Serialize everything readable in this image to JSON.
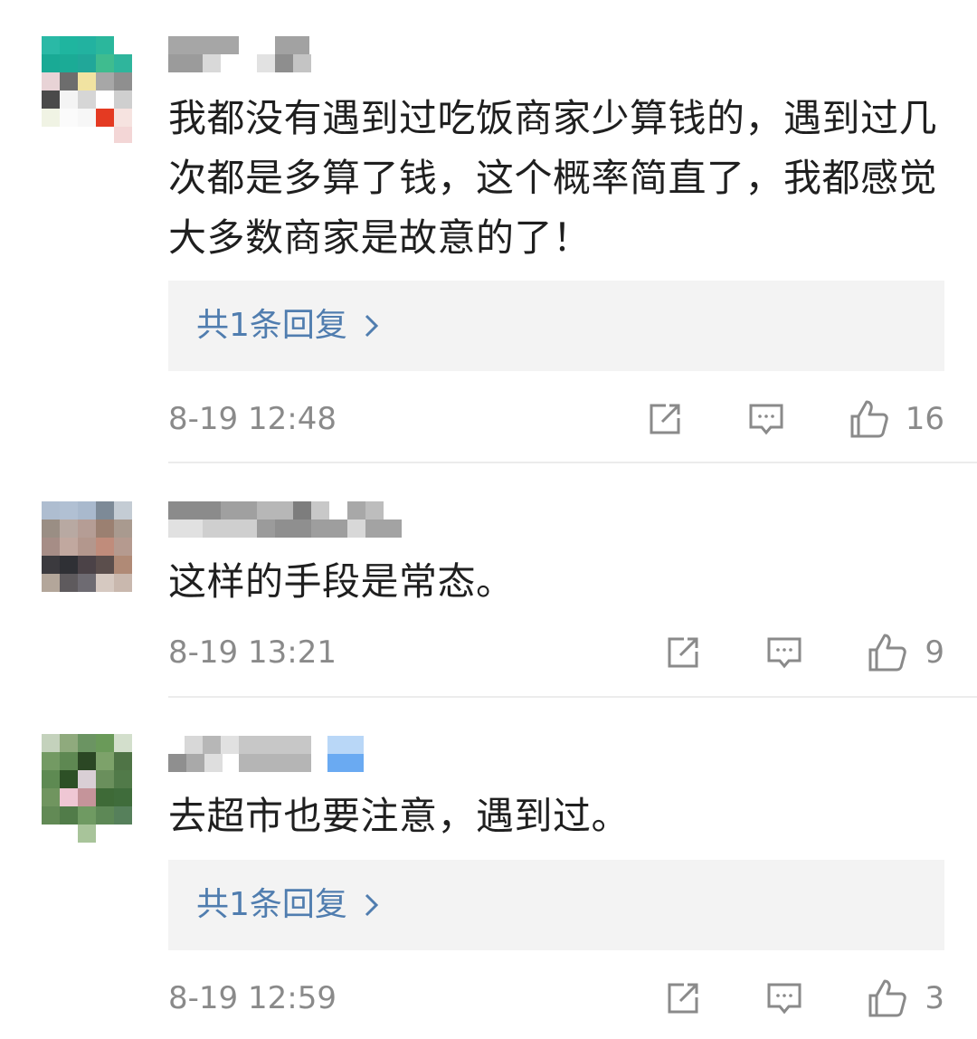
{
  "comments": [
    {
      "text": "我都没有遇到过吃饭商家少算钱的，遇到过几次都是多算了钱，这个概率简直了，我都感觉大多数商家是故意的了！",
      "reply_label": "共1条回复",
      "time": "8-19 12:48",
      "likes": "16",
      "icons": [
        "share-icon",
        "comment-icon",
        "like-icon"
      ]
    },
    {
      "text": "这样的手段是常态。",
      "time": "8-19 13:21",
      "likes": "9",
      "icons": [
        "share-icon",
        "comment-icon",
        "like-icon"
      ]
    },
    {
      "text": "去超市也要注意，遇到过。",
      "reply_label": "共1条回复",
      "time": "8-19 12:59",
      "likes": "3",
      "icons": [
        "share-icon",
        "comment-icon",
        "like-icon"
      ]
    }
  ],
  "colors": {
    "link": "#507daf",
    "meta": "#8a8a8a",
    "reply_bg": "#f3f3f3"
  }
}
